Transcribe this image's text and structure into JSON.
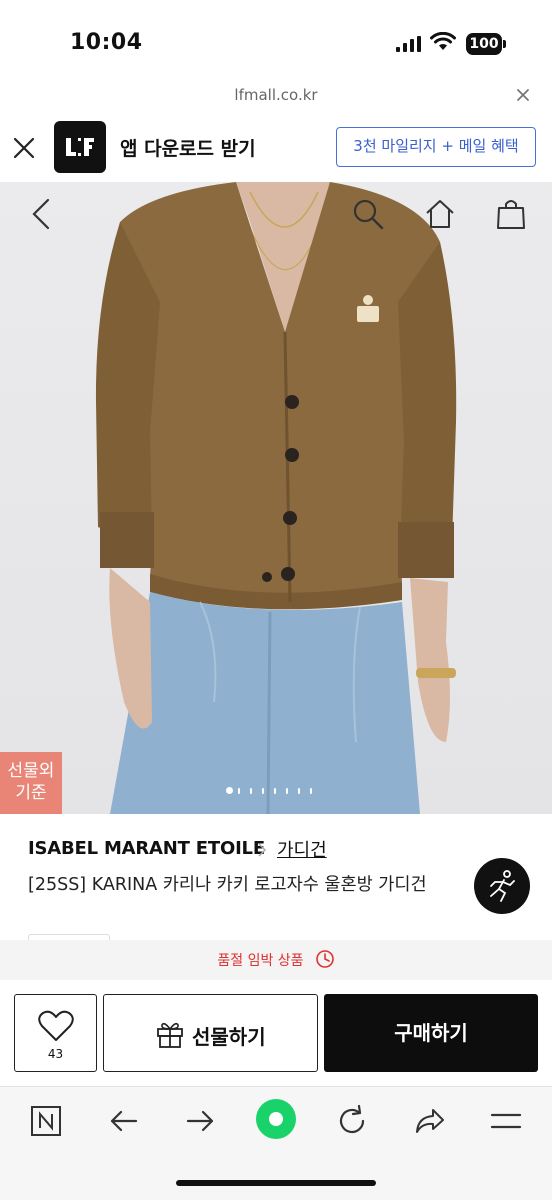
{
  "status_bar": {
    "time": "10:04",
    "battery": "100"
  },
  "url_bar": {
    "domain": "lfmall.co.kr"
  },
  "app_banner": {
    "logo_text": "LF",
    "title": "앱 다운로드 받기",
    "cta_label": "3천 마일리지 + 메일 혜택"
  },
  "hero": {
    "gift_badge_line1": "선물외",
    "gift_badge_line2": "기준",
    "image_count": 8,
    "active_index": 0
  },
  "product": {
    "brand": "ISABEL MARANT ETOILE",
    "category": "가디건",
    "name": "[25SS] KARINA 카리나 카키 로고자수 울혼방 가디건"
  },
  "notice": {
    "text": "품절 임박 상품"
  },
  "actions": {
    "wish_count": "43",
    "gift_label": "선물하기",
    "buy_label": "구매하기"
  },
  "colors": {
    "accent_blue": "#3a5fcf",
    "alert_red": "#e03131",
    "badge_coral": "#e98577",
    "browser_green": "#19d36a",
    "buy_black": "#0d0d0d"
  }
}
